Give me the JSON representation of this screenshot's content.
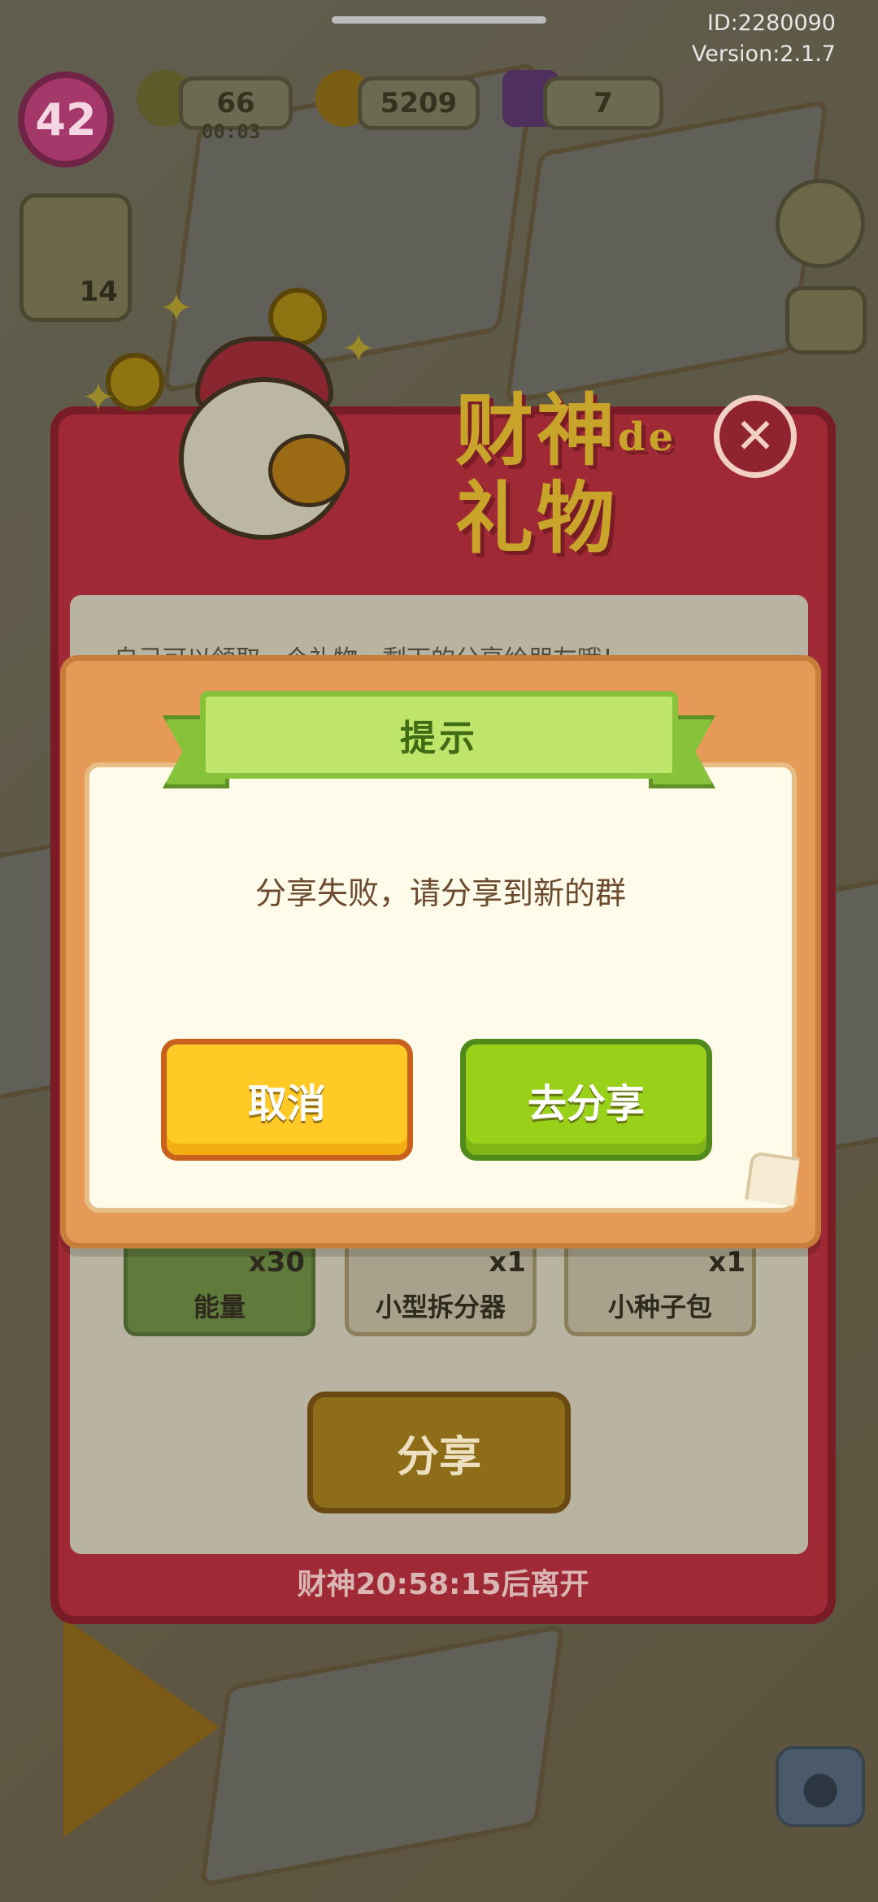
{
  "meta": {
    "id_label": "ID:2280090",
    "version_label": "Version:2.1.7"
  },
  "hud": {
    "level": "42",
    "energy_value": "66",
    "energy_timer": "00:03",
    "coins": "5209",
    "gems": "7",
    "side_badge": "14"
  },
  "gift_panel": {
    "title_line1": "财神",
    "title_de": "de",
    "title_line2": "礼物",
    "hint_text": "自己可以领取一个礼物，剩下的分享给朋友哦！",
    "items": [
      {
        "label": "能量",
        "count": "x30"
      },
      {
        "label": "小型拆分器",
        "count": "x1"
      },
      {
        "label": "小种子包",
        "count": "x1"
      }
    ],
    "share_label": "分享",
    "timer_text": "财神20:58:15后离开"
  },
  "dialog": {
    "title": "提示",
    "message": "分享失败，请分享到新的群",
    "cancel_label": "取消",
    "confirm_label": "去分享"
  },
  "colors": {
    "dialog_frame": "#e59a57",
    "ribbon": "#bfe56b",
    "cancel_button": "#ffc926",
    "confirm_button": "#99d11a",
    "message_text": "#6b4a2e"
  }
}
